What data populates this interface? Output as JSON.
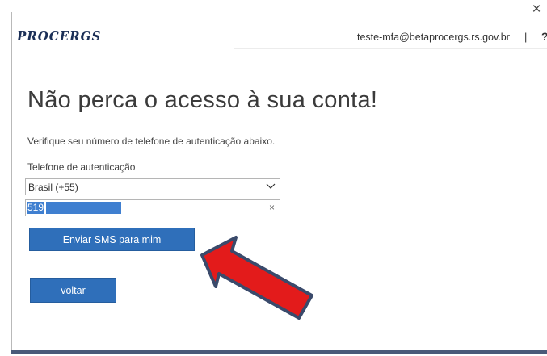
{
  "header": {
    "logo_text": "PROCERGS",
    "user_email": "teste-mfa@betaprocergs.rs.gov.br",
    "separator": "|",
    "help_label": "?",
    "close_label": "×"
  },
  "main": {
    "title": "Não perca o acesso à sua conta!",
    "subtitle": "Verifique seu número de telefone de autenticação abaixo.",
    "phone_label": "Telefone de autenticação",
    "country_select": {
      "selected": "Brasil (+55)"
    },
    "phone_input": {
      "value": "519",
      "clear_label": "×"
    },
    "send_sms_button": "Enviar SMS para mim",
    "back_button": "voltar"
  },
  "colors": {
    "primary_button": "#2f6fba",
    "arrow_fill": "#e31b1b",
    "arrow_outline": "#3a4a6b",
    "logo": "#1b2f57"
  }
}
